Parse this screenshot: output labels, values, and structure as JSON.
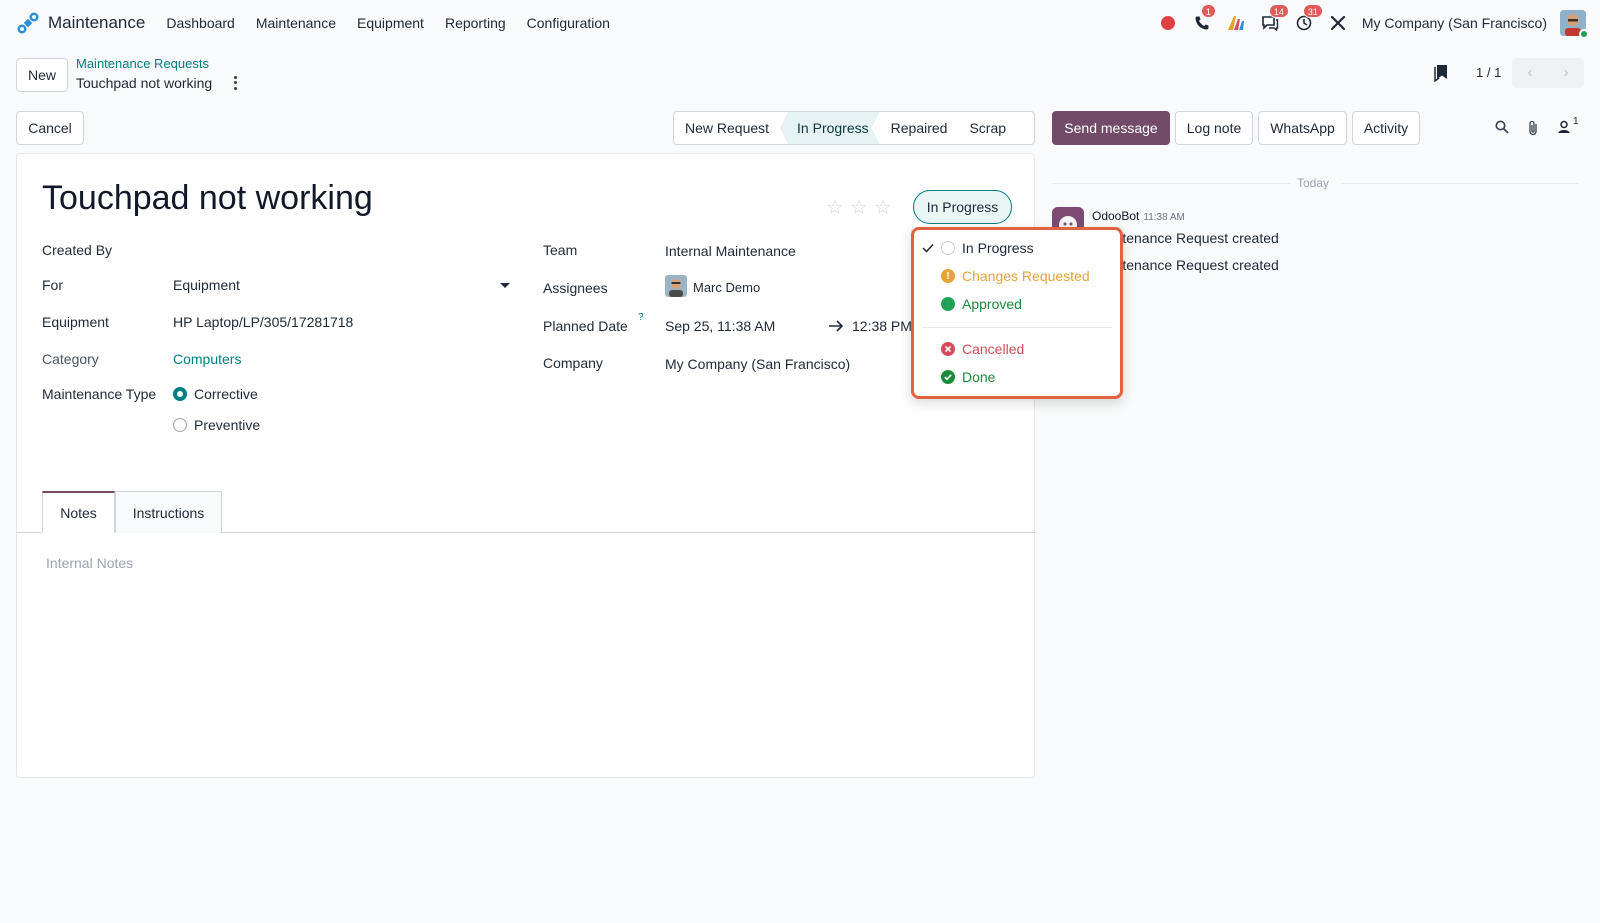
{
  "app": {
    "name": "Maintenance",
    "menu": [
      "Dashboard",
      "Maintenance",
      "Equipment",
      "Reporting",
      "Configuration"
    ],
    "company": "My Company (San Francisco)",
    "badges": {
      "calls": "1",
      "messages": "14",
      "activities": "31"
    }
  },
  "control": {
    "new_label": "New",
    "breadcrumb_parent": "Maintenance Requests",
    "breadcrumb_current": "Touchpad not working",
    "pager": "1 / 1",
    "cancel_label": "Cancel"
  },
  "statusbar": {
    "stages": [
      "New Request",
      "In Progress",
      "Repaired",
      "Scrap"
    ],
    "active_stage": "In Progress"
  },
  "chatter_buttons": {
    "send_message": "Send message",
    "log_note": "Log note",
    "whatsapp": "WhatsApp",
    "activity": "Activity",
    "followers_count": "1"
  },
  "form": {
    "title": "Touchpad not working",
    "state_button": "In Progress",
    "created_by_label": "Created By",
    "for_label": "For",
    "for_value": "Equipment",
    "equipment_label": "Equipment",
    "equipment_value": "HP Laptop/LP/305/17281718",
    "category_label": "Category",
    "category_value": "Computers",
    "maintenance_type_label": "Maintenance Type",
    "maintenance_type_options": [
      "Corrective",
      "Preventive"
    ],
    "maintenance_type_selected": "Corrective",
    "team_label": "Team",
    "team_value": "Internal Maintenance",
    "assignees_label": "Assignees",
    "assignees_value": "Marc Demo",
    "planned_date_label": "Planned Date",
    "planned_date_help": "?",
    "planned_date_start": "Sep 25, 11:38 AM",
    "planned_date_end": "12:38 PM",
    "company_label": "Company",
    "company_value": "My Company (San Francisco)",
    "tabs": [
      "Notes",
      "Instructions"
    ],
    "notes_placeholder": "Internal Notes"
  },
  "state_dropdown": {
    "items": [
      {
        "label": "In Progress",
        "color": "#e5e7eb",
        "checked": true
      },
      {
        "label": "Changes Requested",
        "color": "#e6a23c"
      },
      {
        "label": "Approved",
        "color": "#22a05a"
      },
      {
        "label": "Cancelled",
        "color": "#d44c59"
      },
      {
        "label": "Done",
        "color": "#1b8a3c"
      }
    ]
  },
  "chatter": {
    "date_separator": "Today",
    "author": "OdooBot",
    "time": "11:38 AM",
    "lines": [
      "Maintenance Request created",
      "Maintenance Request created"
    ]
  }
}
